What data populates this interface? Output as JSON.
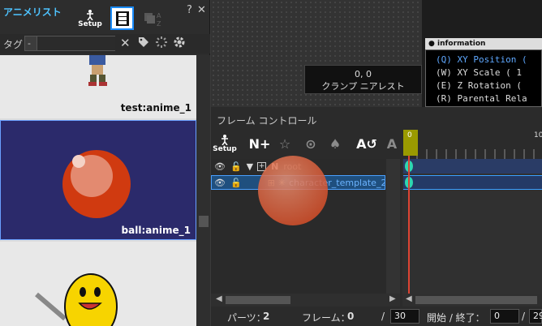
{
  "anime_list": {
    "title": "アニメリスト",
    "setup_label": "Setup",
    "help": "?",
    "close": "✕",
    "tag_label": "タグ",
    "tag_value": "-",
    "items": [
      {
        "label": "test:anime_1"
      },
      {
        "label": "ball:anime_1"
      },
      {
        "label": ""
      }
    ]
  },
  "viewport": {
    "coord": "0, 0",
    "mode": "クランプ ニアレスト"
  },
  "information": {
    "title": "information",
    "lines": [
      {
        "key": "(Q)",
        "text": "XY Position (",
        "highlight": true
      },
      {
        "key": "(W)",
        "text": "XY Scale ( 1",
        "highlight": false
      },
      {
        "key": "(E)",
        "text": "Z Rotation (",
        "highlight": false
      },
      {
        "key": "(R)",
        "text": "Parental Rela",
        "highlight": false
      }
    ]
  },
  "frame_control": {
    "title": "フレーム コントロール",
    "setup_label": "Setup",
    "tree": [
      {
        "name": "root"
      },
      {
        "name": "character_template_2"
      }
    ],
    "ruler": {
      "start": "0",
      "ten": "10"
    },
    "status": {
      "parts_label": "パーツ：",
      "parts_value": "2",
      "frame_label": "フレーム：",
      "frame_value": "0",
      "slash": "/",
      "frame_total": "30",
      "range_label": "開始 / 終了：",
      "range_start": "0",
      "range_end": "29"
    }
  },
  "colors": {
    "accent": "#4ec3ff",
    "selection": "#1f4f7e",
    "keyframe": "#2fd6b0",
    "playhead": "#9a9a00"
  }
}
